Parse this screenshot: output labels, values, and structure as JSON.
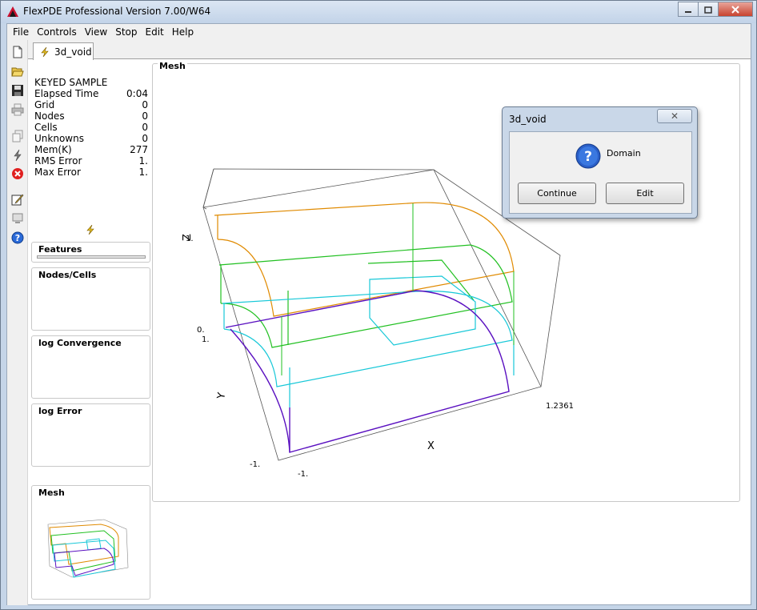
{
  "window": {
    "title": "FlexPDE Professional Version 7.00/W64"
  },
  "menu": [
    "File",
    "Controls",
    "View",
    "Stop",
    "Edit",
    "Help"
  ],
  "tab": {
    "label": "3d_void"
  },
  "info": {
    "heading": "KEYED SAMPLE",
    "rows": [
      {
        "label": "Elapsed Time",
        "value": "0:04"
      },
      {
        "label": "Grid",
        "value": "0"
      },
      {
        "label": "Nodes",
        "value": "0"
      },
      {
        "label": "Cells",
        "value": "0"
      },
      {
        "label": "Unknowns",
        "value": "0"
      },
      {
        "label": "Mem(K)",
        "value": "277"
      },
      {
        "label": "RMS Error",
        "value": "1."
      },
      {
        "label": "Max Error",
        "value": "1."
      }
    ]
  },
  "panels": {
    "features": "Features",
    "nodes_cells": "Nodes/Cells",
    "log_convergence": "log Convergence",
    "log_error": "log Error",
    "mesh_thumb": "Mesh"
  },
  "mesh": {
    "title": "Mesh",
    "z_axis": "Z",
    "y_axis": "Y",
    "x_axis": "X",
    "z_max": "1.",
    "z_min": "0.",
    "y_max": "1.",
    "y_min": "-1.",
    "x_min": "-1.",
    "x_max": "1.2361"
  },
  "dialog": {
    "title": "3d_void",
    "message": "Domain",
    "continue_label": "Continue",
    "edit_label": "Edit"
  },
  "colors": {
    "orange": "#e08a00",
    "green": "#22c022",
    "cyan": "#18c8d8",
    "purple": "#5a10c0"
  },
  "icons": [
    "new-file-icon",
    "open-folder-icon",
    "save-icon",
    "print-icon",
    "copy-icon",
    "run-icon",
    "stop-icon",
    "edit-icon",
    "monitor-icon",
    "help-icon"
  ]
}
